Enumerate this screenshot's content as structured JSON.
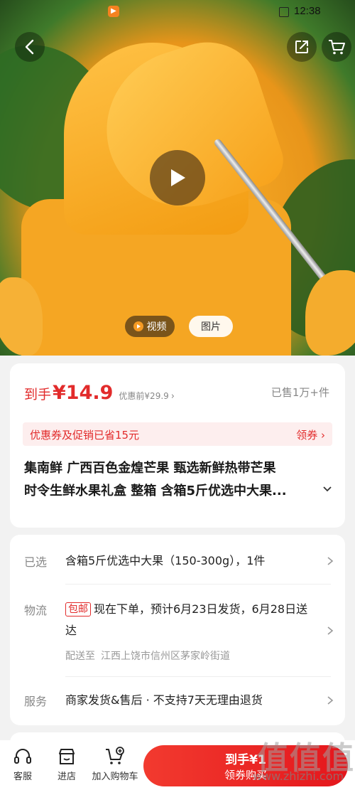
{
  "status_bar": {
    "time": "12:38"
  },
  "hero": {
    "tabs": {
      "video": "视频",
      "image": "图片"
    }
  },
  "price_card": {
    "price_label": "到手",
    "price_value": "¥14.9",
    "original_price": "优惠前¥29.9",
    "sold": "已售1万+件",
    "promo_text": "优惠券及促销已省15元",
    "promo_link": "领券",
    "title_line1": "集南鲜  广西百色金煌芒果 甄选新鲜热带芒果",
    "title_line2": "时令生鲜水果礼盒 整箱 含箱5斤优选中大果..."
  },
  "spec_card": {
    "selected_label": "已选",
    "selected_value": "含箱5斤优选中大果（150-300g），1件",
    "logistics_label": "物流",
    "free_shipping_tag": "包邮",
    "logistics_value": "现在下单，预计6月23日发货，6月28日送达",
    "ship_to_label": "配送至",
    "ship_to_address": "江西上饶市信州区茅家岭街道",
    "service_label": "服务",
    "service_value": "商家发货&售后 · 不支持7天无理由退货"
  },
  "bottom_bar": {
    "service": "客服",
    "store": "进店",
    "add_to_cart": "加入购物车",
    "buy_main": "到手¥1",
    "buy_sub": "领券购买"
  },
  "watermark": {
    "cn": "值值值",
    "url": "www.zhizhi.com"
  },
  "colors": {
    "accent": "#e22b2b",
    "promo_bg": "#fdeeee"
  },
  "icons": [
    "back-icon",
    "share-icon",
    "cart-icon",
    "play-icon",
    "headset-icon",
    "store-icon",
    "add-cart-icon",
    "chevron-right-icon",
    "chevron-down-icon"
  ]
}
